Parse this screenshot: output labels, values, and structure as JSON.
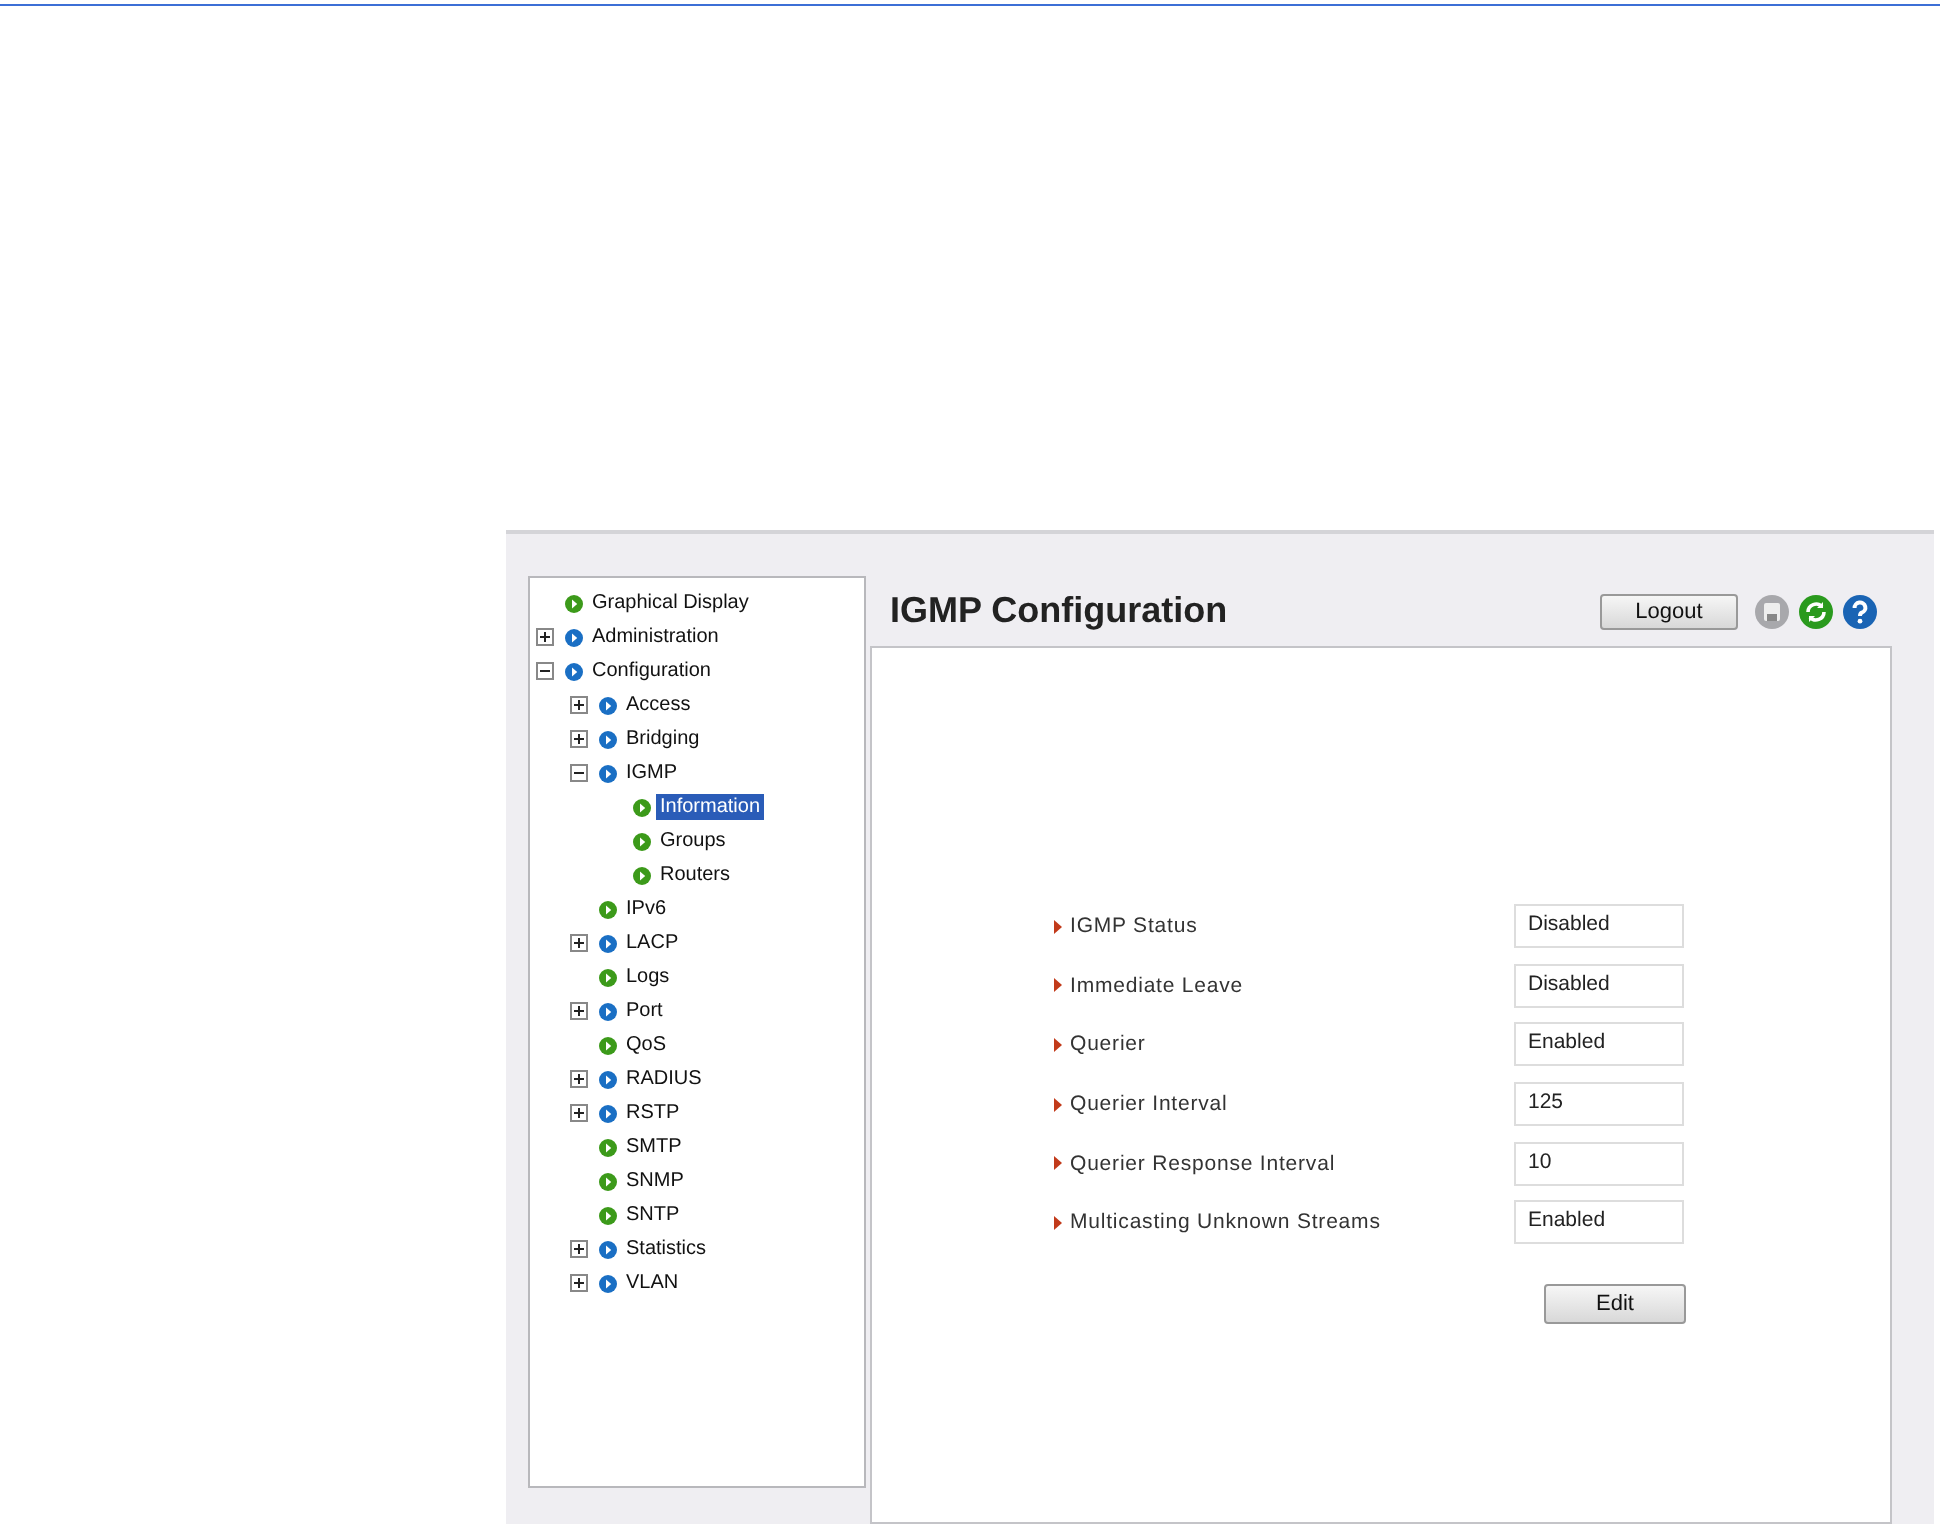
{
  "tree": [
    {
      "label": "Graphical Display",
      "kind": "page",
      "selected": false
    },
    {
      "label": "Administration",
      "kind": "folder",
      "expanded": false,
      "selected": false
    },
    {
      "label": "Configuration",
      "kind": "folder",
      "expanded": true,
      "selected": false,
      "children": [
        {
          "label": "Access",
          "kind": "folder",
          "expanded": false,
          "selected": false
        },
        {
          "label": "Bridging",
          "kind": "folder",
          "expanded": false,
          "selected": false
        },
        {
          "label": "IGMP",
          "kind": "folder",
          "expanded": true,
          "selected": false,
          "children": [
            {
              "label": "Information",
              "kind": "page",
              "selected": true
            },
            {
              "label": "Groups",
              "kind": "page",
              "selected": false
            },
            {
              "label": "Routers",
              "kind": "page",
              "selected": false
            }
          ]
        },
        {
          "label": "IPv6",
          "kind": "page",
          "selected": false
        },
        {
          "label": "LACP",
          "kind": "folder",
          "expanded": false,
          "selected": false
        },
        {
          "label": "Logs",
          "kind": "page",
          "selected": false
        },
        {
          "label": "Port",
          "kind": "folder",
          "expanded": false,
          "selected": false
        },
        {
          "label": "QoS",
          "kind": "page",
          "selected": false
        },
        {
          "label": "RADIUS",
          "kind": "folder",
          "expanded": false,
          "selected": false
        },
        {
          "label": "RSTP",
          "kind": "folder",
          "expanded": false,
          "selected": false
        },
        {
          "label": "SMTP",
          "kind": "page",
          "selected": false
        },
        {
          "label": "SNMP",
          "kind": "page",
          "selected": false
        },
        {
          "label": "SNTP",
          "kind": "page",
          "selected": false
        },
        {
          "label": "Statistics",
          "kind": "folder",
          "expanded": false,
          "selected": false
        },
        {
          "label": "VLAN",
          "kind": "folder",
          "expanded": false,
          "selected": false
        }
      ]
    }
  ],
  "header": {
    "title": "IGMP Configuration",
    "logout": "Logout"
  },
  "settings": [
    {
      "label": "IGMP Status",
      "value": "Disabled"
    },
    {
      "label": "Immediate Leave",
      "value": "Disabled"
    },
    {
      "label": "Querier",
      "value": "Enabled"
    },
    {
      "label": "Querier Interval",
      "value": "125"
    },
    {
      "label": "Querier Response Interval",
      "value": "10"
    },
    {
      "label": "Multicasting Unknown Streams",
      "value": "Enabled"
    }
  ],
  "edit_button": "Edit"
}
